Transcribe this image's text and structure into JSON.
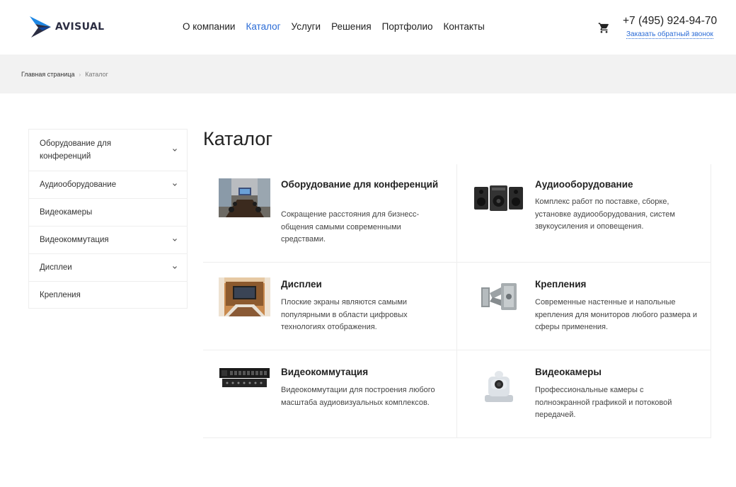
{
  "header": {
    "logo_text": "AVISUAL",
    "nav": [
      {
        "label": "О компании",
        "active": false
      },
      {
        "label": "Каталог",
        "active": true
      },
      {
        "label": "Услуги",
        "active": false
      },
      {
        "label": "Решения",
        "active": false
      },
      {
        "label": "Портфолио",
        "active": false
      },
      {
        "label": "Контакты",
        "active": false
      }
    ],
    "phone": "+7 (495) 924-94-70",
    "callback_label": "Заказать обратный звонок",
    "cart_icon": "cart-icon"
  },
  "breadcrumb": {
    "home": "Главная страница",
    "separator": "›",
    "current": "Каталог"
  },
  "sidebar": {
    "items": [
      {
        "label": "Оборудование для конференций",
        "has_submenu": true
      },
      {
        "label": "Аудиооборудование",
        "has_submenu": true
      },
      {
        "label": "Видеокамеры",
        "has_submenu": false
      },
      {
        "label": "Видеокоммутация",
        "has_submenu": true
      },
      {
        "label": "Дисплеи",
        "has_submenu": true
      },
      {
        "label": "Крепления",
        "has_submenu": false
      }
    ]
  },
  "main": {
    "title": "Каталог",
    "cards": [
      {
        "title": "Оборудование для конференций",
        "desc": "Сокращение расстояния для бизнесс-общения самыми современными средствами.",
        "icon": "conference-room-image"
      },
      {
        "title": "Аудиооборудование",
        "desc": "Комплекс работ по поставке, сборке, установке аудиооборудования, систем звукоусиления и оповещения.",
        "icon": "speakers-image"
      },
      {
        "title": "Дисплеи",
        "desc": "Плоские экраны являются самыми популярными в области цифровых технологиях отображения.",
        "icon": "display-room-image"
      },
      {
        "title": "Крепления",
        "desc": "Современные настенные и напольные крепления для мониторов любого размера и сферы применения.",
        "icon": "wall-mount-image"
      },
      {
        "title": "Видеокоммутация",
        "desc": "Видеокоммутации для построения любого масштаба аудиовизуальных комплексов.",
        "icon": "video-switcher-image"
      },
      {
        "title": "Видеокамеры",
        "desc": "Профессиональные камеры с полноэкранной графикой и потоковой передачей.",
        "icon": "ptz-camera-image"
      }
    ]
  },
  "colors": {
    "accent": "#2a6bd6",
    "band": "#f2f2f2",
    "logo_dark": "#2b2d42",
    "logo_blue": "#1e88e5"
  }
}
